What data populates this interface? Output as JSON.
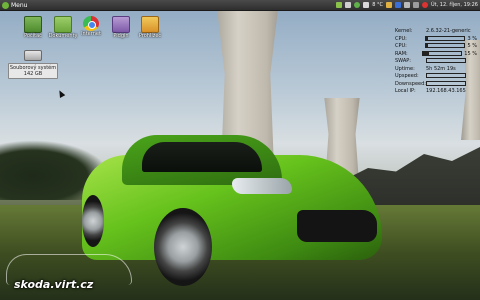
{
  "panel": {
    "menu_label": "Menu",
    "temperature": "8 °C",
    "clock": "Út, 12. říjen, 19:26",
    "tray_icons": [
      "app-icon",
      "audio-icon",
      "shield-icon",
      "weather-icon",
      "mail-icon",
      "bluetooth-icon",
      "network-icon",
      "user-icon",
      "power-icon"
    ]
  },
  "desktop": {
    "icons": [
      {
        "name": "icon-pocitac",
        "label": "Počítač",
        "icon": "computer-icon"
      },
      {
        "name": "icon-dokumenty",
        "label": "Dokumenty",
        "icon": "folder-icon"
      },
      {
        "name": "icon-internet",
        "label": "Internet",
        "icon": "chrome-icon"
      },
      {
        "name": "icon-pidgin",
        "label": "Pidgin",
        "icon": "pidgin-icon"
      },
      {
        "name": "icon-prohlizec",
        "label": "Prohlížeč",
        "icon": "image-viewer-icon"
      }
    ],
    "drive": {
      "label": "Souborový systém",
      "size": "142 GB",
      "icon": "drive-icon"
    }
  },
  "conky": {
    "kernel_label": "Kernel:",
    "kernel": "2.6.32-21-generic",
    "cpu1_label": "CPU:",
    "cpu1": "3 %",
    "cpu1_level": 0.03,
    "cpu2_label": "CPU:",
    "cpu2": "5 %",
    "cpu2_level": 0.05,
    "ram_label": "RAM:",
    "ram": "15 %",
    "ram_level": 0.15,
    "swap_label": "SWAP:",
    "swap": "",
    "swap_level": 0,
    "uptime_label": "Uptime:",
    "uptime": "5h 52m 19s",
    "upspeed_label": "Upspeed:",
    "upspeed_level": 0,
    "downspeed_label": "Downspeed:",
    "downspeed_level": 0,
    "localip_label": "Local IP:",
    "localip": "192.168.43.165"
  },
  "watermark": {
    "text": "skoda.virt.cz"
  },
  "colors": {
    "car": "#66c21c",
    "panel": "#3a3a3a",
    "accent_green": "#6fb33b"
  }
}
